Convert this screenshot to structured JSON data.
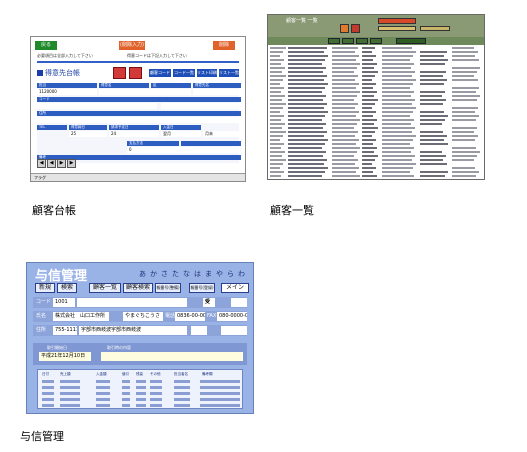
{
  "captions": {
    "customer_ledger": "顧客台帳",
    "customer_list": "顧客一覧",
    "credit_management": "与信管理"
  },
  "ledger_window": {
    "btn_green": "戻る",
    "btn_orange_mid": "(削除入力)",
    "btn_orange_right": "削除",
    "note_left": "必要項目は全部入力して下さい",
    "note_right": "得意コードは下記入力して下さい",
    "title": "得意先台帳",
    "tabs": [
      "顧客コード",
      "コード一覧",
      "リスト印刷",
      "リスト一覧"
    ],
    "labels": [
      "担当",
      "得意名",
      "区",
      "得意先名",
      "コード",
      "住所",
      "TEL",
      "得意締日",
      "請求予定日",
      "入金日",
      "支払方法",
      "備考"
    ],
    "values": [
      "1120000",
      "25",
      "24",
      "翌月",
      "月末",
      "0"
    ],
    "status": "フラグ"
  },
  "list_window": {
    "title": "顧客一覧 一覧"
  },
  "credit_window": {
    "title": "与信管理",
    "kana_index": [
      "あ",
      "か",
      "さ",
      "た",
      "な",
      "は",
      "ま",
      "や",
      "ら",
      "わ"
    ],
    "menu": [
      "新規",
      "検索",
      "顧客一覧",
      "顧客検索",
      "報番号(整備)",
      "報番号(登録)",
      "メイン"
    ],
    "code_label": "コード",
    "code_value": "1001",
    "name_label": "氏名",
    "name_value": "株式会社　山口工作所",
    "kana_value": "やまぐちこうさ",
    "tel_label": "電話",
    "tel_value": "0836-00-000",
    "fax_label": "FAX",
    "fax_value": "080-0000-0000",
    "addr_label": "住所",
    "zip_value": "755-1111",
    "addr_value": "宇部市西岐波宇部市西岐波",
    "receive_label": "受",
    "date_label": "取引開始日",
    "date_value": "平成21年12月10日",
    "memo_label": "取引時の内容",
    "table_headers": [
      "日付",
      "売上額",
      "入金額",
      "値引",
      "残高",
      "その他",
      "担当者名",
      "備考欄"
    ]
  }
}
